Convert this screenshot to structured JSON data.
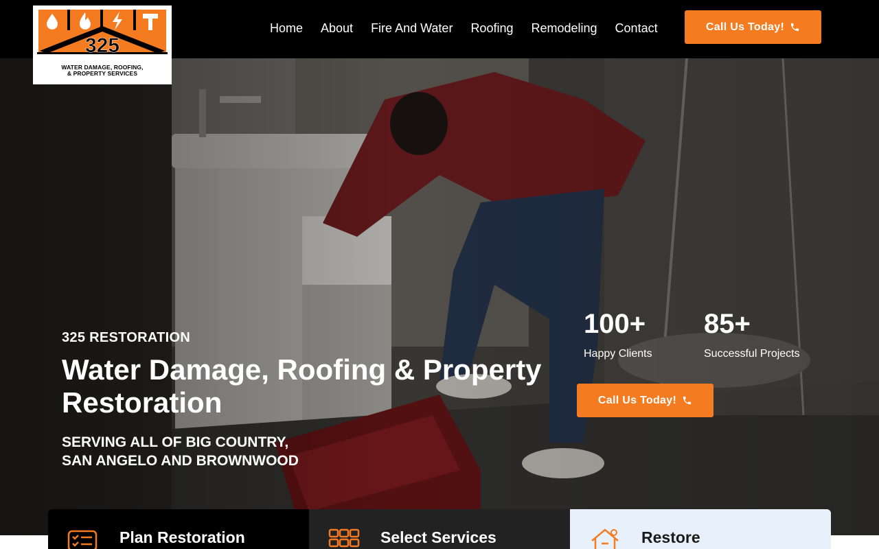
{
  "logo": {
    "mark": "325",
    "subtitle_line1": "WATER DAMAGE, ROOFING,",
    "subtitle_line2": "& PROPERTY SERVICES"
  },
  "nav": {
    "items": [
      "Home",
      "About",
      "Fire And Water",
      "Roofing",
      "Remodeling",
      "Contact"
    ]
  },
  "header_cta": {
    "label": "Call Us Today!",
    "icon": "phone-icon"
  },
  "hero": {
    "eyebrow": "325 RESTORATION",
    "headline": "Water Damage, Roofing & Property Restoration",
    "serving_line1": "SERVING ALL OF BIG COUNTRY,",
    "serving_line2": "SAN ANGELO AND BROWNWOOD",
    "stats": [
      {
        "value": "100+",
        "label": "Happy Clients"
      },
      {
        "value": "85+",
        "label": "Successful Projects"
      }
    ],
    "cta": {
      "label": "Call Us Today!",
      "icon": "phone-icon"
    }
  },
  "cards": [
    {
      "title": "Plan Restoration",
      "icon": "checklist-icon"
    },
    {
      "title": "Select Services",
      "icon": "grid-select-icon"
    },
    {
      "title": "Restore",
      "icon": "house-repair-icon"
    }
  ],
  "colors": {
    "accent": "#f47b20",
    "header_bg": "#000000",
    "card_light": "#e8f1fb"
  }
}
